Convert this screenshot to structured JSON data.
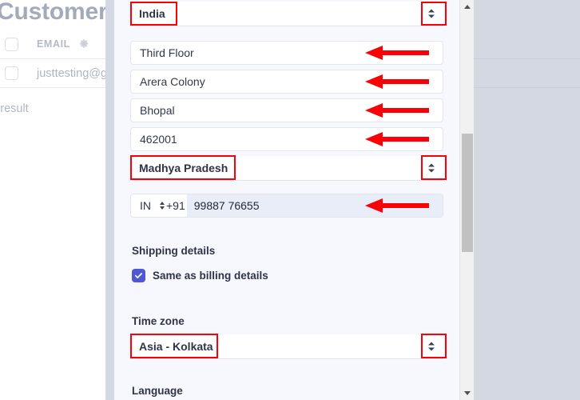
{
  "background": {
    "page_title": "Customers",
    "table": {
      "columns": [
        "EMAIL"
      ],
      "column_icon": "gear-icon",
      "rows": [
        {
          "email": "justtesting@gmail"
        }
      ]
    },
    "result_count_text": "l result"
  },
  "panel": {
    "fields": [
      {
        "name": "country",
        "type": "select",
        "value": "India",
        "icon": "chevron-up-down-icon",
        "highlighted": true
      },
      {
        "name": "address-line-1",
        "type": "text",
        "value": "Third Floor",
        "arrow": true
      },
      {
        "name": "address-line-2",
        "type": "text",
        "value": "Arera Colony",
        "arrow": true
      },
      {
        "name": "city",
        "type": "text",
        "value": "Bhopal",
        "arrow": true
      },
      {
        "name": "postal-code",
        "type": "text",
        "value": "462001",
        "arrow": true
      },
      {
        "name": "state",
        "type": "select",
        "value": "Madhya Pradesh",
        "icon": "chevron-up-down-icon",
        "highlighted": true
      }
    ],
    "phone": {
      "country_code": "IN",
      "dial_prefix": "+91",
      "number": "99887 76655",
      "icon": "chevron-up-down-icon",
      "arrow": true
    },
    "shipping": {
      "heading": "Shipping details",
      "checkbox_label": "Same as billing details",
      "checkbox_checked": true
    },
    "timezone": {
      "label": "Time zone",
      "value": "Asia - Kolkata",
      "icon": "chevron-up-down-icon",
      "highlighted": true
    },
    "language": {
      "label": "Language"
    },
    "scrollbar": {
      "up_icon": "triangle-up-icon",
      "down_icon": "triangle-down-icon"
    }
  },
  "colors": {
    "annotation_red": "#fb0007",
    "accent_indigo": "#5057d6",
    "panel_bg": "#f6f8fd",
    "overlay_dim": "#d3d8e2",
    "phone_input_bg": "#e9edf8"
  }
}
